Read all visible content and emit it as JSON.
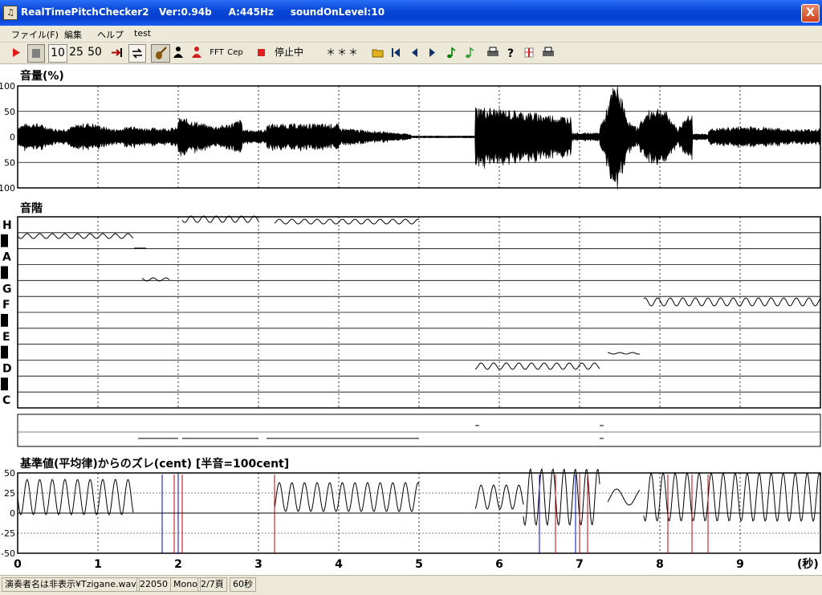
{
  "window": {
    "title": "RealTimePitchChecker2   Ver:0.94b     A:445Hz     soundOnLevel:10",
    "close_label": "X"
  },
  "menu": [
    "ファイル(F)",
    "編集",
    "ヘルプ",
    "test"
  ],
  "toolbar": {
    "zoom_10": "10",
    "zoom_25": "25",
    "zoom_50": "50",
    "fft_label": "FFT",
    "cep_label": "Cep",
    "status_label": "停止中",
    "note_display": "＊＊＊"
  },
  "volume_panel": {
    "title": "音量(%)",
    "ticks": [
      "100",
      "50",
      "0",
      "50",
      "100"
    ]
  },
  "scale_panel": {
    "title": "音階",
    "notes": [
      "H",
      "A",
      "G",
      "F",
      "E",
      "D",
      "C"
    ]
  },
  "cent_panel": {
    "title": "基準値(平均律)からのズレ(cent) [半音=100cent]",
    "ticks": [
      "50",
      "25",
      "0",
      "-25",
      "-50"
    ]
  },
  "time_axis": {
    "ticks": [
      "0",
      "1",
      "2",
      "3",
      "4",
      "5",
      "6",
      "7",
      "8",
      "9"
    ],
    "unit": "(秒)"
  },
  "status": {
    "file": "演奏者名は非表示¥Tzigane.wav",
    "rate": "22050",
    "channels": "Mono",
    "page": "2/7頁",
    "duration": "60秒"
  }
}
